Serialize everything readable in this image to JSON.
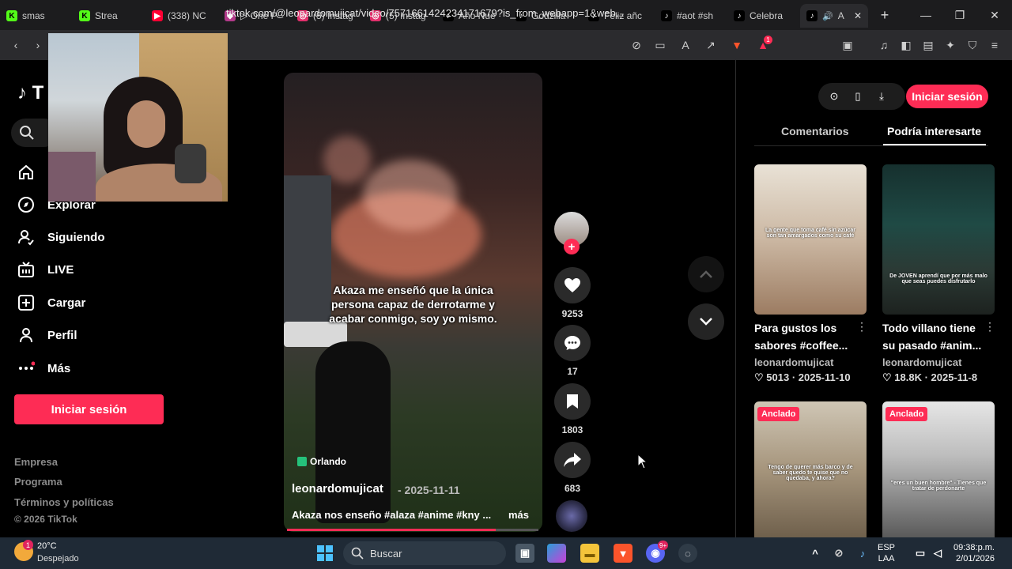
{
  "browser": {
    "tabs": [
      {
        "label": "smas",
        "icon": "kick-icon",
        "color": "#53fc18"
      },
      {
        "label": "Strea",
        "icon": "kick-icon",
        "color": "#53fc18"
      },
      {
        "label": "(338) NC",
        "icon": "youtube-icon",
        "color": "#ff0033"
      },
      {
        "label": "▷ One P",
        "icon": "app-icon",
        "color": "#b23a8a"
      },
      {
        "label": "(5) Instag",
        "icon": "instagram-icon",
        "color": "#e1306c"
      },
      {
        "label": "(5) Instag",
        "icon": "instagram-icon",
        "color": "#e1306c"
      },
      {
        "label": "Año Nue",
        "icon": "tiktok-icon",
        "color": "#000000"
      },
      {
        "label": "Godzilla",
        "icon": "tiktok-icon",
        "color": "#000000"
      },
      {
        "label": "Feliz añc",
        "icon": "tiktok-icon",
        "color": "#000000"
      },
      {
        "label": "#aot #sh",
        "icon": "tiktok-icon",
        "color": "#000000"
      },
      {
        "label": "Celebra",
        "icon": "tiktok-icon",
        "color": "#000000"
      },
      {
        "label": "A",
        "icon": "tiktok-icon",
        "color": "#000000"
      }
    ],
    "url": "tiktok.com/@leonardomujicat/video/7571661424234171679?is_from_webapp=1&web...",
    "brave_badge": "1"
  },
  "sidebar": {
    "logo": "T",
    "nav": [
      {
        "label": "Explorar",
        "icon": "compass-icon"
      },
      {
        "label": "Siguiendo",
        "icon": "following-icon"
      },
      {
        "label": "LIVE",
        "icon": "live-icon"
      },
      {
        "label": "Cargar",
        "icon": "upload-icon"
      },
      {
        "label": "Perfil",
        "icon": "profile-icon"
      },
      {
        "label": "Más",
        "icon": "more-icon"
      }
    ],
    "login_label": "Iniciar sesión",
    "footer": [
      "Empresa",
      "Programa",
      "Términos y políticas"
    ],
    "copyright": "© 2026 TikTok"
  },
  "video": {
    "caption": "Akaza me enseñó que la única persona capaz de derrotarme y acabar conmigo, soy yo mismo.",
    "location": "Orlando",
    "author": "leonardomujicat",
    "date": "- 2025-11-11",
    "description": "Akaza nos enseño #alaza #anime #kny ...",
    "more_label": "más",
    "progress": 0.83,
    "likes": "9253",
    "comments": "17",
    "saves": "1803",
    "shares": "683"
  },
  "right_panel": {
    "login_label": "Iniciar sesión",
    "tabs": [
      "Comentarios",
      "Podría interesarte"
    ],
    "active_tab": 1,
    "cards": [
      {
        "title": "Para gustos los sabores #coffee...",
        "author": "leonardomujicat",
        "likes": "5013",
        "date": "2025-11-10",
        "overlay": "La gente que toma café sin azúcar son tan amargados como su café"
      },
      {
        "title": "Todo villano tiene su pasado #anim...",
        "author": "leonardomujicat",
        "likes": "18.8K",
        "date": "2025-11-8",
        "overlay": "De JOVEN aprendí que por más malo que seas puedes disfrutarlo"
      },
      {
        "pinned": "Anclado",
        "overlay": "Tengo de querer más barco y de saber quedo te quise que no quedaba, y ahora?"
      },
      {
        "pinned": "Anclado",
        "overlay": "\"eres un buen hombre\" - Tienes que tratar de perdonarte"
      }
    ]
  },
  "taskbar": {
    "temp": "20°C",
    "weather": "Despejado",
    "search": "Buscar",
    "lang": "ESP",
    "lang2": "LAA",
    "time": "09:38:p.m.",
    "date": "2/01/2026",
    "weather_badge": "1",
    "discord_badge": "9+"
  }
}
